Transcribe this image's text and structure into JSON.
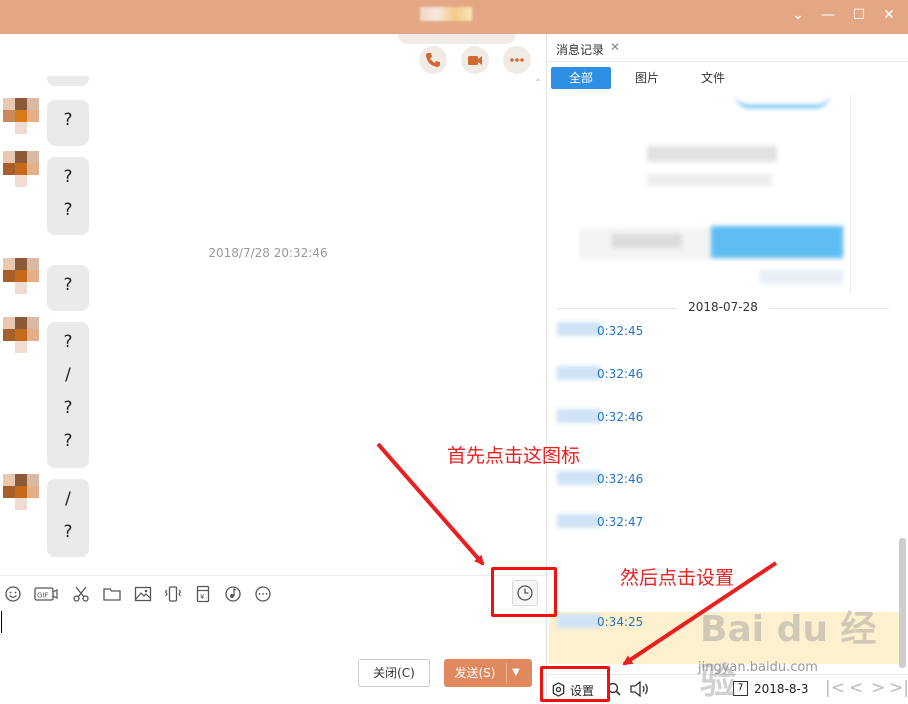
{
  "window": {
    "controls": {
      "minimize": "—",
      "maximize": "☐",
      "close": "✕"
    }
  },
  "chat": {
    "timestamp": "2018/7/28 20:32:46",
    "messages": [
      {
        "lines": [
          "?"
        ]
      },
      {
        "lines": [
          "?",
          "?"
        ]
      },
      {
        "lines": [
          "?"
        ]
      },
      {
        "lines": [
          "?",
          "/",
          "?",
          "?"
        ]
      },
      {
        "lines": [
          "/",
          "?"
        ]
      }
    ]
  },
  "buttons": {
    "close_label": "关闭(C)",
    "send_label": "发送(S)",
    "send_dropdown": "▼"
  },
  "history": {
    "tab_label": "消息记录",
    "tab_close": "✕",
    "filters": [
      "全部",
      "图片",
      "文件"
    ],
    "date_separator": "2018-07-28",
    "records": [
      {
        "time": "0:32:45"
      },
      {
        "time": "0:32:46"
      },
      {
        "time": "0:32:46"
      },
      {
        "time": "0:32:46"
      },
      {
        "time": "0:32:47"
      },
      {
        "time": "0:34:25"
      }
    ],
    "settings_label": "设置",
    "date_value": "2018-8-3",
    "calendar_day": "7"
  },
  "annotations": {
    "first": "首先点击这图标",
    "then": "然后点击设置"
  },
  "watermark": {
    "brand": "Bai du 经验",
    "url": "jingyan.baidu.com"
  },
  "colors": {
    "titlebar": "#e4a784",
    "accent": "#2e8fe4",
    "send": "#e0895e",
    "annotation": "#e82020"
  }
}
